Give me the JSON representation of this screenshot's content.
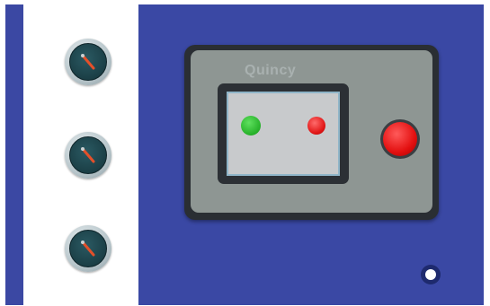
{
  "controller": {
    "brand": "Quincy"
  },
  "gauges": [
    {
      "label": "gauge-1"
    },
    {
      "label": "gauge-2"
    },
    {
      "label": "gauge-3"
    }
  ],
  "colors": {
    "panel_blue": "#3a48a4",
    "controller_gray": "#8e9693",
    "led_green": "#25b028",
    "led_red": "#e01414",
    "stop_button_red": "#e31010"
  },
  "icons": {
    "gauge": "pressure-gauge-icon",
    "status_green": "green-led-icon",
    "status_red": "red-led-icon",
    "stop": "stop-button-icon",
    "indicator": "indicator-light-icon"
  }
}
